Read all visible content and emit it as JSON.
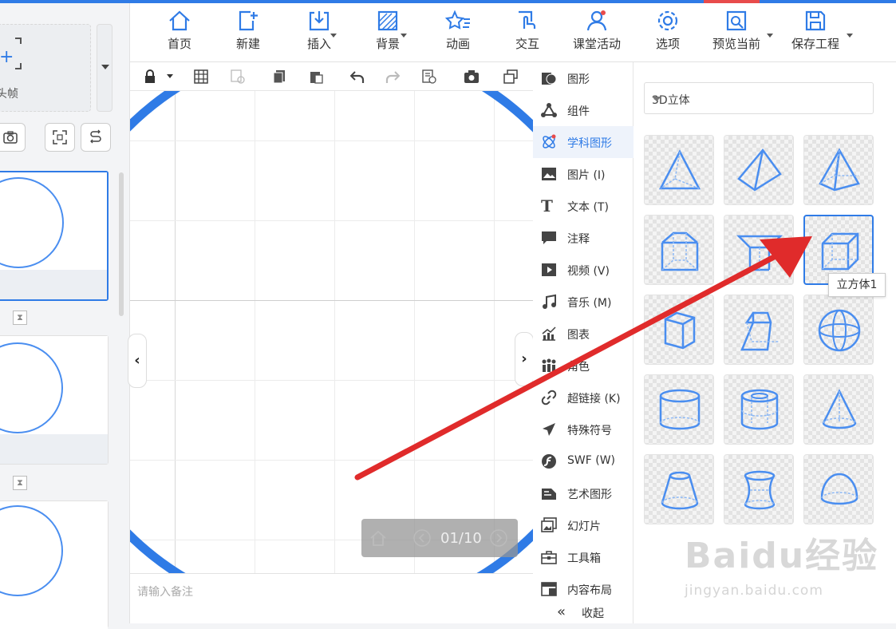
{
  "left_panel": {
    "keyframe_label": "头帧",
    "transition_glyph": "⧗"
  },
  "toolbar": {
    "items": [
      {
        "label": "首页",
        "icon": "home-icon"
      },
      {
        "label": "新建",
        "icon": "new-file-icon"
      },
      {
        "label": "插入",
        "icon": "insert-icon"
      },
      {
        "label": "背景",
        "icon": "background-icon"
      },
      {
        "label": "动画",
        "icon": "animation-icon"
      },
      {
        "label": "交互",
        "icon": "interact-icon"
      },
      {
        "label": "课堂活动",
        "icon": "class-activity-icon"
      },
      {
        "label": "选项",
        "icon": "gear-icon"
      },
      {
        "label": "预览当前",
        "icon": "preview-icon"
      },
      {
        "label": "保存工程",
        "icon": "save-icon"
      }
    ]
  },
  "canvas": {
    "notes_placeholder": "请输入备注",
    "page_indicator": "01/10"
  },
  "menu": {
    "items": [
      {
        "label": "图形"
      },
      {
        "label": "组件"
      },
      {
        "label": "学科图形"
      },
      {
        "label": "图片 (I)"
      },
      {
        "label": "文本 (T)"
      },
      {
        "label": "注释"
      },
      {
        "label": "视频 (V)"
      },
      {
        "label": "音乐 (M)"
      },
      {
        "label": "图表"
      },
      {
        "label": "角色"
      },
      {
        "label": "超链接 (K)"
      },
      {
        "label": "特殊符号"
      },
      {
        "label": "SWF (W)"
      },
      {
        "label": "艺术图形"
      },
      {
        "label": "幻灯片"
      },
      {
        "label": "工具箱"
      },
      {
        "label": "内容布局"
      },
      {
        "label": "收起"
      }
    ]
  },
  "panel": {
    "category_select": "3D立体",
    "tooltip": "立方体1",
    "shapes": [
      "triangular-pyramid",
      "pyramid",
      "square-pyramid",
      "pentagonal-prism",
      "triangular-prism",
      "cube",
      "hexagonal-prism",
      "frustum",
      "sphere",
      "cylinder",
      "hollow-cylinder",
      "cone",
      "truncated-cone",
      "hyperboloid",
      "hemisphere"
    ]
  },
  "watermark": {
    "brand": "Baidu经验",
    "url": "jingyan.baidu.com"
  },
  "colors": {
    "accent": "#2f7be6",
    "arrow": "#e02b2b",
    "shape_stroke": "#4a8ef0"
  }
}
